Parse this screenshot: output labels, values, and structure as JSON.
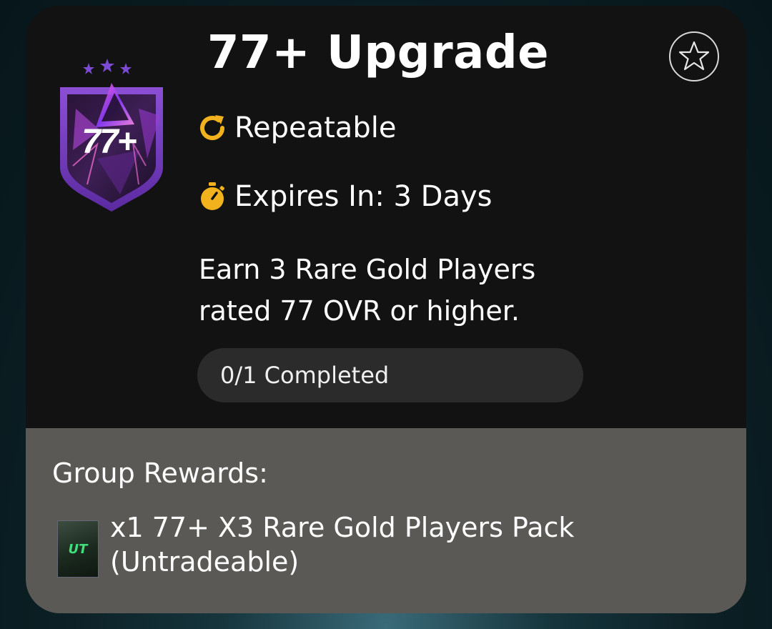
{
  "objective": {
    "title": "77+ Upgrade",
    "badge_text": "77+",
    "favorite_icon": "star-outline-icon",
    "repeatable_label": "Repeatable",
    "repeat_icon": "repeat-icon",
    "expires_label": "Expires In: 3 Days",
    "timer_icon": "stopwatch-icon",
    "description_line1": "Earn 3 Rare Gold Players",
    "description_line2": "rated 77 OVR or higher.",
    "progress": "0/1 Completed",
    "accent_color": "#f2b21e"
  },
  "rewards": {
    "label": "Group Rewards:",
    "items": [
      {
        "pack_logo": "UT",
        "line1": "x1 77+ X3 Rare Gold Players Pack",
        "line2": "(Untradeable)"
      }
    ]
  }
}
